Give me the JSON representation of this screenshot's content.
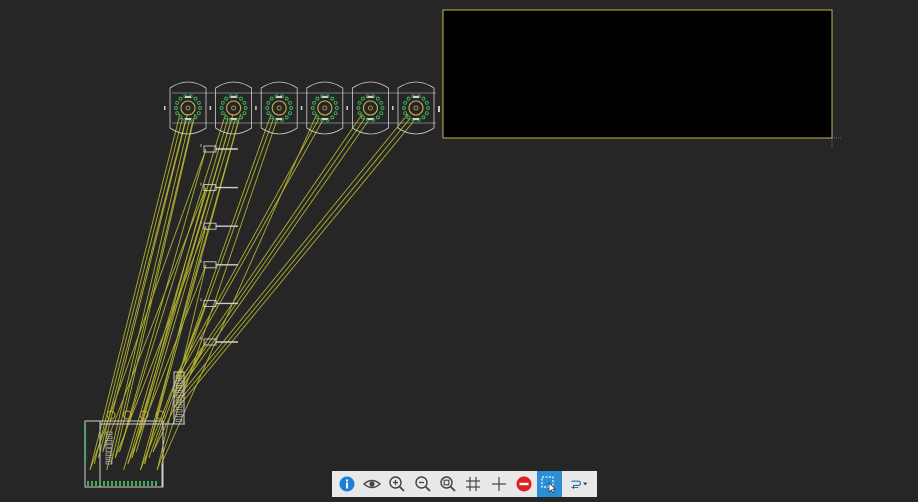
{
  "canvas": {
    "background": "#262626",
    "ratsnest_color": "#c8c832",
    "outline_color": "#cfcfcf",
    "pad_color": "#3fae5a",
    "selection_color": "#c9b24a"
  },
  "board": {
    "encoders": 6,
    "side_components": 6
  },
  "toolbar": {
    "buttons": [
      {
        "id": "info",
        "icon": "info-icon",
        "active": false
      },
      {
        "id": "view",
        "icon": "eye-icon",
        "active": false
      },
      {
        "id": "zoom_in",
        "icon": "zoom-in-icon",
        "active": false
      },
      {
        "id": "zoom_out",
        "icon": "zoom-out-icon",
        "active": false
      },
      {
        "id": "zoom_fit",
        "icon": "zoom-fit-icon",
        "active": false
      },
      {
        "id": "grid",
        "icon": "grid-icon",
        "active": false
      },
      {
        "id": "crosshair",
        "icon": "crosshair-icon",
        "active": false
      },
      {
        "id": "delete",
        "icon": "delete-icon",
        "active": false
      },
      {
        "id": "select",
        "icon": "select-area-icon",
        "active": true
      },
      {
        "id": "route",
        "icon": "route-menu-icon",
        "active": false
      }
    ]
  }
}
